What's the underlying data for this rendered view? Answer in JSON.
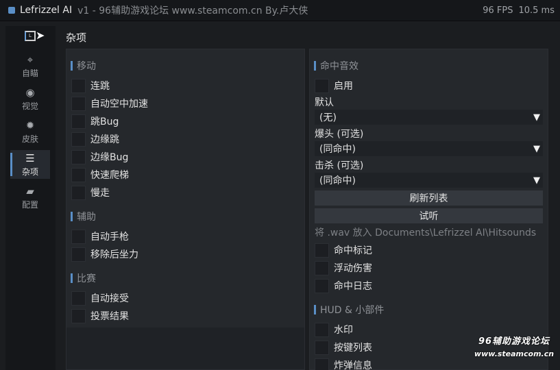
{
  "window": {
    "app_name": "Lefrizzel AI",
    "subtitle": "v1 - 96辅助游戏论坛 www.steamcom.cn By.卢大侠",
    "fps": "96 FPS",
    "frame_time": "10.5 ms"
  },
  "sidebar": {
    "logo_text": "L",
    "items": [
      {
        "label": "自瞄",
        "icon": "crosshair-icon",
        "glyph": "⌖"
      },
      {
        "label": "视觉",
        "icon": "eye-icon",
        "glyph": "◉"
      },
      {
        "label": "皮肤",
        "icon": "palette-icon",
        "glyph": "✹"
      },
      {
        "label": "杂项",
        "icon": "sliders-icon",
        "glyph": "☰"
      },
      {
        "label": "配置",
        "icon": "folder-icon",
        "glyph": "▰"
      }
    ],
    "active": "杂项"
  },
  "page": {
    "title": "杂项"
  },
  "left_panel": {
    "movement": {
      "title": "移动",
      "options": [
        "连跳",
        "自动空中加速",
        "跳Bug",
        "边缘跳",
        "边缘Bug",
        "快速爬梯",
        "慢走"
      ]
    },
    "assist": {
      "title": "辅助",
      "options": [
        "自动手枪",
        "移除后坐力"
      ]
    },
    "match": {
      "title": "比赛",
      "options": [
        "自动接受",
        "投票结果"
      ]
    }
  },
  "right_panel": {
    "hitsound": {
      "title": "命中音效",
      "enable_label": "启用",
      "default_label": "默认",
      "default_value": "(无)",
      "headshot_label": "爆头 (可选)",
      "headshot_value": "(同命中)",
      "kill_label": "击杀 (可选)",
      "kill_value": "(同命中)",
      "refresh_button": "刷新列表",
      "preview_button": "试听",
      "hint": "将 .wav 放入 Documents\\Lefrizzel AI\\Hitsounds",
      "options": [
        "命中标记",
        "浮动伤害",
        "命中日志"
      ]
    },
    "hud": {
      "title": "HUD & 小部件",
      "options": [
        "水印",
        "按键列表",
        "炸弹信息"
      ]
    }
  },
  "watermark": {
    "title": "96辅助游戏论坛",
    "url": "www.steamcom.cn"
  }
}
